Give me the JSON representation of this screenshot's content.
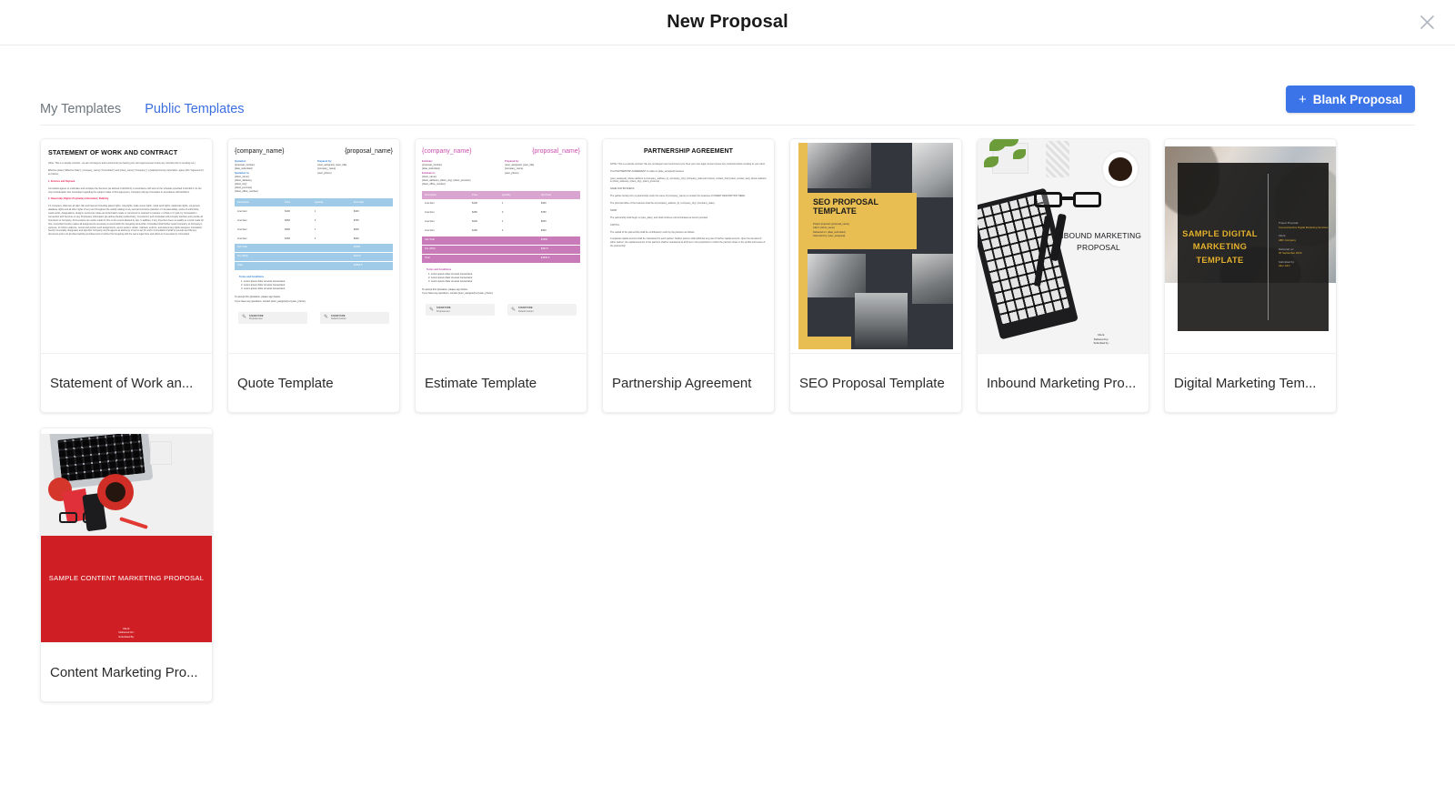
{
  "header": {
    "title": "New Proposal",
    "close_icon": "close-icon"
  },
  "toolbar": {
    "tabs": [
      {
        "label": "My Templates",
        "active": false
      },
      {
        "label": "Public Templates",
        "active": true
      }
    ],
    "blank_button": {
      "plus": "+",
      "label": "Blank Proposal",
      "color": "#3b74e8"
    }
  },
  "templates": [
    {
      "title": "Statement of Work an...",
      "kind": "sow"
    },
    {
      "title": "Quote Template",
      "kind": "quote"
    },
    {
      "title": "Estimate Template",
      "kind": "estimate"
    },
    {
      "title": "Partnership Agreement",
      "kind": "partnership"
    },
    {
      "title": "SEO Proposal Template",
      "kind": "seo"
    },
    {
      "title": "Inbound Marketing Pro...",
      "kind": "inbound"
    },
    {
      "title": "Digital Marketing Tem...",
      "kind": "digital"
    },
    {
      "title": "Content Marketing Pro...",
      "kind": "content"
    }
  ],
  "sow": {
    "heading": "STATEMENT OF WORK AND CONTRACT",
    "note": "[Note: This is a sample contract - we are not lawyers and recommend you having your own legal counsel review any contract prior to sending out.]",
    "effective": "Effective [date] (\"Effective Date\"),  {company_name} (\"Consultant\") and {client_name} (\"Company\"), a [state/province] corporation, agree (this \"Agreement\") as follows:",
    "s1_heading": "1. Services and Payment",
    "s1_body": "Consultant agrees to undertake and complete the Services (as defined in Exhibit A) in accordance with and on the schedule specified in Exhibit A. As the only consideration due Consultant regarding the subject matter of this Agreement, Company will pay Consultant in accordance with Exhibit A.",
    "s2_heading": "2. Ownership; Rights; Proprietary Information; Publicity",
    "s2_body": "2.1  Company shall own all right, title and interest (including patent rights, copyrights, trade secret rights, mask work rights, trademark rights, sui generis database rights and all other rights of any sort throughout the world) relating to any and all inventions (whether or not patentable), works of authorship, mask works, designations, designs, know-how, ideas and information made or conceived or reduced to practice, in whole or in part, by Consultant in connection with Services or any Proprietary Information (as defined below) (collectively, \"Inventions\") and Consultant will promptly disclose and provide all Inventions to Company. All Inventions are works made for hire to the extent allowed by law. In addition, if any Invention does not qualify as a work made for hire, Consultant hereby makes all assignments necessary to accomplish the foregoing ownership. Consultant shall further assist Company, at Company's expense, to further evidence, record and perfect such assignments, and to perfect, obtain, maintain, enforce, and defend any rights assigned. Consultant hereby irrevocably designates and appoints Company and its agents as attorneys in fact to act for and in Consultant's behalf to execute and file any document and to do all other lawfully permitted acts to further the foregoing with the same legal force and effect as if executed by Consultant."
  },
  "quote": {
    "company": "{company_name}",
    "proposal": "{proposal_name}",
    "left_label1": "Quotation:",
    "left_lines1": [
      "{proposal_number}",
      "{date_submitted}"
    ],
    "left_label2": "Quotation to:",
    "left_lines2": [
      "{client_name}",
      "{client_address},",
      "{client_city},",
      "{client_province}",
      "{client_office_number}"
    ],
    "right_label": "Prepared by:",
    "right_lines": [
      "{user_assigned}, {user_title}",
      "{company_name}",
      "{user_phone}"
    ],
    "columns": [
      "Description",
      "Price",
      "Quantity",
      "Sub Total"
    ],
    "rows": [
      [
        "Line Item",
        "$100",
        "1",
        "$100"
      ],
      [
        "Line Item",
        "$250",
        "3",
        "$750"
      ],
      [
        "Line Item",
        "$200",
        "1",
        "$200"
      ],
      [
        "Line Item",
        "$150",
        "2",
        "$300"
      ]
    ],
    "summary": [
      [
        "Sub Total",
        "",
        "",
        "$1350"
      ],
      [
        "Tax (15%)",
        "",
        "",
        "$202.5"
      ],
      [
        "Total",
        "",
        "",
        "$1552.5"
      ]
    ],
    "terms_title": "Terms and Conditions",
    "terms": [
      "1. Lorem ipsum dolor sit amet consectetur.",
      "2. Lorem ipsum dolor sit amet consectetur.",
      "3. Lorem ipsum dolor sit amet consectetur."
    ],
    "accept1": "To accept this Quotation, please sign below.",
    "accept2": "If you have any questions, contact {user_assigned} at {user_phone}.",
    "sig1_title": "SIGNATURE",
    "sig1_sub": "Proposal user",
    "sig2_title": "SIGNATURE",
    "sig2_sub": "Default Contact"
  },
  "estimate": {
    "company": "{company_name}",
    "proposal": "{proposal_name}",
    "left_label1": "Estimate:",
    "left_lines1": [
      "{proposal_number}",
      "{date_submitted}"
    ],
    "left_label2": "Estimate to:",
    "left_lines2": [
      "{client_name}",
      "{client_address}, {client_city}, {client_province}",
      "{client_office_number}"
    ],
    "right_label": "Prepared by:",
    "right_lines": [
      "{user_assigned}, {user_title}",
      "{company_name}",
      "{user_phone}"
    ],
    "columns": [
      "Description",
      "Price",
      "Quantity",
      "Sub Total"
    ],
    "rows": [
      [
        "Line Item",
        "$100",
        "1",
        "$100"
      ],
      [
        "Line Item",
        "$250",
        "3",
        "$750"
      ],
      [
        "Line Item",
        "$200",
        "1",
        "$200"
      ],
      [
        "Line Item",
        "$150",
        "2",
        "$300"
      ]
    ],
    "summary": [
      [
        "Sub Total",
        "",
        "",
        "$1350"
      ],
      [
        "Tax (15%)",
        "",
        "",
        "$202.5"
      ],
      [
        "Total",
        "",
        "",
        "$1552.5"
      ]
    ],
    "terms_title": "Terms and Conditions",
    "terms": [
      "1. Lorem ipsum dolor sit amet consectetur.",
      "2. Lorem ipsum dolor sit amet consectetur.",
      "3. Lorem ipsum dolor sit amet consectetur."
    ],
    "accept1": "To accept this Quotation, please sign below.",
    "accept2": "If you have any questions, contact {user_assigned} at {user_phone}.",
    "sig1_title": "SIGNATURE",
    "sig1_sub": "Proposal user",
    "sig2_title": "SIGNATURE",
    "sig2_sub": "Default Contact"
  },
  "partnership": {
    "heading": "PARTNERSHIP AGREEMENT",
    "note": "NOTE: This is a sample contract. We are not lawyers and recommend you have your own legal counsel review any contracts before sending to your client.",
    "made_on": "This PARTNERSHIP AGREEMENT is made on {date_accepted} between",
    "parties": "{user_assigned}, whose address is {company_address_1}, {company_city}, {company_state} and {client_contact_first} {client_contact_last}, whose address is {client_address}, {client_city}, {client_province}.",
    "h_name": "NAME AND BUSINESS",
    "name_body": "The parties hereby form a partnership under the name of {company_name} to conduct the business of INSERT DESCRIPTION HERE.",
    "office": "The principal office of the business shall be at {company_address_2}, {company_city}, {company_state}.",
    "h_term": "TERM",
    "term_body": "The partnership shall begin on {due_date}, and shall continue until terminated as herein provided.",
    "h_capital": "CAPITAL",
    "capital_body": "The capital of the partnership shall be contributed in cash by the partners as follows:",
    "capital_body2": "A separate capital account shall be maintained for each partner. Neither partner shall withdraw any part of his/her capital account. Upon the demand of either partner, the capital accounts of the partners shall be maintained at all times in the proportions in which the partners share in the profits and losses of the partnership."
  },
  "seo": {
    "title": "SEO PROPOSAL TEMPLATE",
    "meta": [
      "Project proposal: {proposal_name}",
      "Client: {client_name}",
      "Delivered on: {date_submitted}",
      "Submitted by: {user_assigned}"
    ],
    "accent": "#e8bd52"
  },
  "inbound": {
    "title": "INBOUND MARKETING PROPOSAL",
    "meta": [
      "Client:",
      "Delivered by:",
      "Submitted by:"
    ]
  },
  "digital": {
    "title": "SAMPLE DIGITAL MARKETING TEMPLATE",
    "fields": [
      {
        "label": "Project Proposal:",
        "value": "Comprehensive Digital Marketing Services"
      },
      {
        "label": "Client:",
        "value": "ABC Company"
      },
      {
        "label": "Delivered on:",
        "value": "25 September 2019"
      },
      {
        "label": "Submitted by:",
        "value": "Alex John"
      }
    ],
    "accent": "#e6b430"
  },
  "content": {
    "title": "SAMPLE CONTENT MARKETING PROPOSAL",
    "meta": [
      "Client:",
      "Delivered On:",
      "Submitted By:"
    ],
    "accent": "#cf1f25"
  }
}
